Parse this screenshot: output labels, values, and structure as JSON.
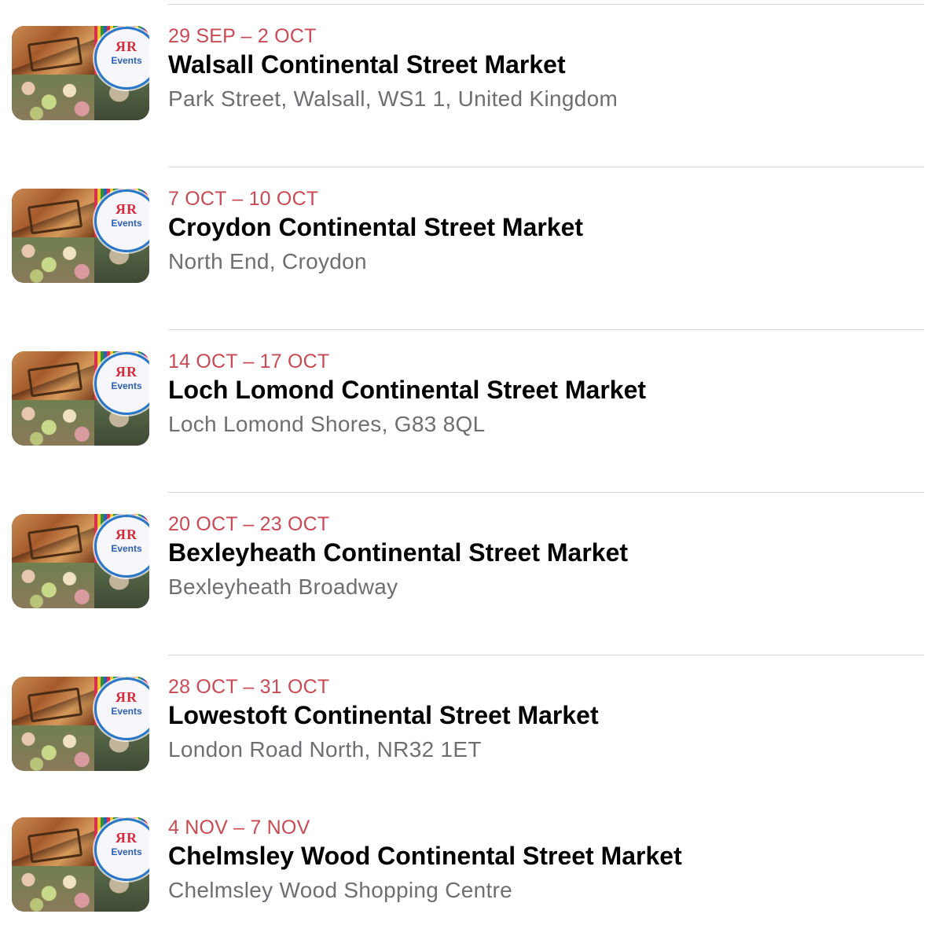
{
  "events": [
    {
      "date": "29 SEP – 2 OCT",
      "title": "Walsall Continental Street Market",
      "location": "Park Street, Walsall, WS1 1, United Kingdom",
      "thumb_logo": "ЯR",
      "thumb_logo_sub": "Events"
    },
    {
      "date": "7 OCT – 10 OCT",
      "title": "Croydon Continental Street Market",
      "location": "North End, Croydon",
      "thumb_logo": "ЯR",
      "thumb_logo_sub": "Events"
    },
    {
      "date": "14 OCT – 17 OCT",
      "title": "Loch Lomond Continental Street Market",
      "location": "Loch Lomond Shores, G83 8QL",
      "thumb_logo": "ЯR",
      "thumb_logo_sub": "Events"
    },
    {
      "date": "20 OCT – 23 OCT",
      "title": "Bexleyheath Continental Street Market",
      "location": "Bexleyheath Broadway",
      "thumb_logo": "ЯR",
      "thumb_logo_sub": "Events"
    },
    {
      "date": "28 OCT – 31 OCT",
      "title": "Lowestoft Continental Street Market",
      "location": "London Road North, NR32 1ET",
      "thumb_logo": "ЯR",
      "thumb_logo_sub": "Events"
    },
    {
      "date": "4 NOV – 7 NOV",
      "title": "Chelmsley Wood Continental Street Market",
      "location": "Chelmsley Wood Shopping Centre",
      "thumb_logo": "ЯR",
      "thumb_logo_sub": "Events"
    }
  ],
  "colors": {
    "date": "#c94a55",
    "title": "#000000",
    "location": "#6e6e73",
    "divider": "#d6d6d9"
  }
}
